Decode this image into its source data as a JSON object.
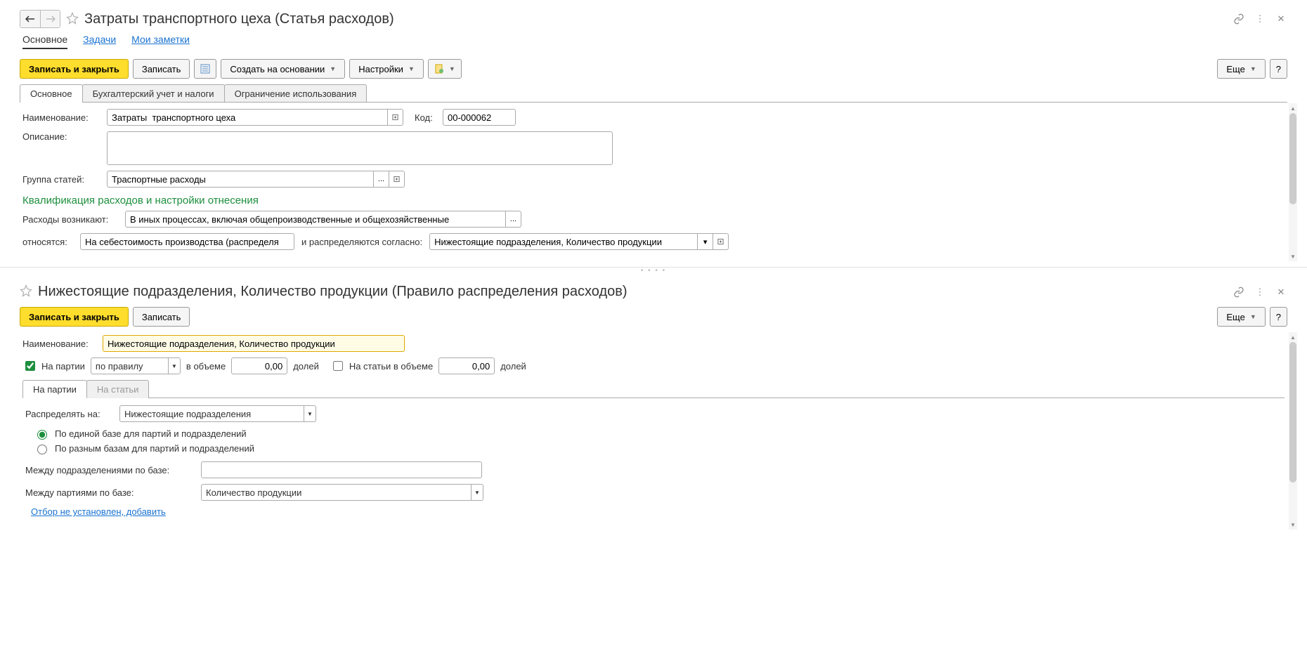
{
  "form1": {
    "title": "Затраты  транспортного цеха (Статья расходов)",
    "navTabs": {
      "main": "Основное",
      "tasks": "Задачи",
      "notes": "Мои заметки"
    },
    "toolbar": {
      "saveClose": "Записать и закрыть",
      "save": "Записать",
      "createBased": "Создать на основании",
      "settings": "Настройки",
      "more": "Еще"
    },
    "subTabs": {
      "main": "Основное",
      "accounting": "Бухгалтерский учет и налоги",
      "restriction": "Ограничение использования"
    },
    "fields": {
      "nameLabel": "Наименование:",
      "nameValue": "Затраты  транспортного цеха",
      "codeLabel": "Код:",
      "codeValue": "00-000062",
      "descLabel": "Описание:",
      "descValue": "",
      "groupLabel": "Группа статей:",
      "groupValue": "Траспортные расходы",
      "sectionTitle": "Квалификация расходов и настройки отнесения",
      "originsLabel": "Расходы возникают:",
      "originsValue": "В иных процессах, включая общепроизводственные и общехозяйственные",
      "refersLabel": "относятся:",
      "refersValue": "На себестоимость производства (распределя",
      "distLabel": "и распределяются согласно:",
      "distValue": "Нижестоящие подразделения, Количество продукции"
    }
  },
  "form2": {
    "title": "Нижестоящие подразделения, Количество продукции (Правило распределения расходов)",
    "toolbar": {
      "saveClose": "Записать и закрыть",
      "save": "Записать",
      "more": "Еще"
    },
    "fields": {
      "nameLabel": "Наименование:",
      "nameValue": "Нижестоящие подразделения, Количество продукции",
      "toBatchesLabel": "На партии",
      "byRuleValue": "по правилу",
      "volumeLabel": "в объеме",
      "volumeValue": "0,00",
      "sharesLabel": "долей",
      "toItemsLabel": "На статьи в объеме",
      "itemsVolumeValue": "0,00",
      "sharesLabel2": "долей",
      "tabBatches": "На партии",
      "tabItems": "На статьи",
      "distributeLabel": "Распределять на:",
      "distributeValue": "Нижестоящие подразделения",
      "radio1": "По единой базе для партий и подразделений",
      "radio2": "По разным базам для партий и подразделений",
      "baseSubdivLabel": "Между подразделениями по базе:",
      "baseBatchLabel": "Между партиями по базе:",
      "baseBatchValue": "Количество продукции",
      "filterLink": "Отбор не установлен, добавить"
    }
  }
}
